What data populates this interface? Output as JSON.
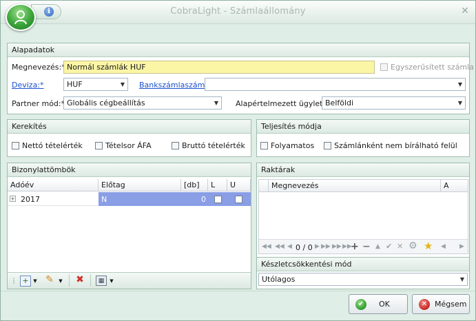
{
  "window": {
    "title": "CobraLight - Számlaállomány"
  },
  "alapadatok": {
    "header": "Alapadatok",
    "megnevezes_label": "Megnevezés:*",
    "megnevezes_value": "Normál számlák HUF",
    "egyszerusitett_label": "Egyszerűsített számla",
    "deviza_label": "Deviza:*",
    "deviza_value": "HUF",
    "bankszamla_label": "Bankszámlaszám:*",
    "bankszamla_value": "",
    "partner_label": "Partner mód:*",
    "partner_value": "Globális cégbeállítás",
    "ugylet_label": "Alapértelmezett ügylet:*",
    "ugylet_value": "Belföldi"
  },
  "kerekites": {
    "header": "Kerekítés",
    "options": [
      "Nettó tételérték",
      "Tételsor ÁFA",
      "Bruttó tételérték"
    ]
  },
  "teljesites": {
    "header": "Teljesítés módja",
    "options": [
      "Folyamatos",
      "Számlánként nem bírálható felül"
    ]
  },
  "bizonylattombok": {
    "header": "Bizonylattömbök",
    "columns": [
      "Adóév",
      "Előtag",
      "[db]",
      "L",
      "U"
    ],
    "rows": [
      {
        "adoev": "2017",
        "elotag": "N",
        "db": "0"
      }
    ]
  },
  "raktarak": {
    "header": "Raktárak",
    "columns": [
      "Megnevezés",
      "A"
    ],
    "nav_counter": "0 / 0"
  },
  "keszlet": {
    "header": "Készletcsökkentési mód",
    "value": "Utólagos"
  },
  "buttons": {
    "ok": "OK",
    "cancel": "Mégsem"
  },
  "colors": {
    "accent_green": "#3aa43a",
    "selection": "#8a9ee6",
    "cancel_red": "#d0312d"
  }
}
